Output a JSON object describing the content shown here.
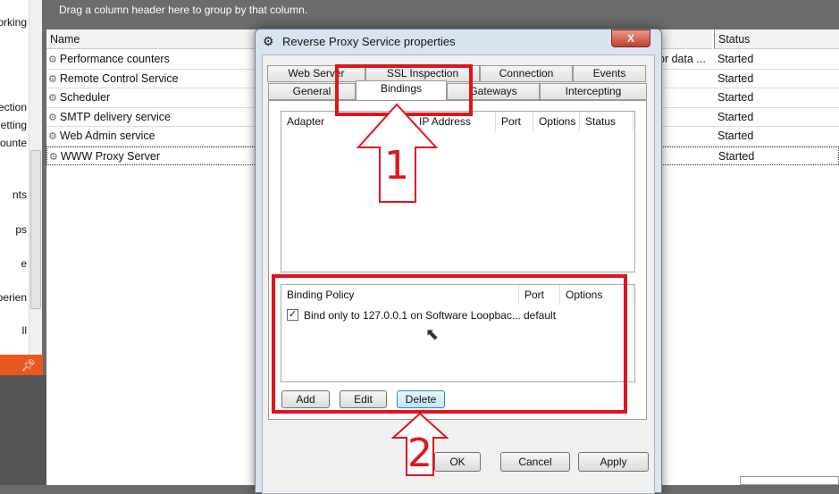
{
  "sidebar": {
    "items": [
      "orking",
      "ection",
      "etting",
      "ounte",
      "nts",
      "ps",
      "e",
      "perien",
      "ll"
    ]
  },
  "grid": {
    "group_hint": "Drag a column header here to group by that column.",
    "columns": [
      "Name",
      "Status"
    ],
    "rows": [
      {
        "name": "Performance counters",
        "desc": "or data ...",
        "status": "Started"
      },
      {
        "name": "Remote Control Service",
        "desc": "",
        "status": "Started"
      },
      {
        "name": "Scheduler",
        "desc": "",
        "status": "Started"
      },
      {
        "name": "SMTP delivery service",
        "desc": "",
        "status": "Started"
      },
      {
        "name": "Web Admin service",
        "desc": "",
        "status": "Started"
      },
      {
        "name": "WWW Proxy Server",
        "desc": "",
        "status": "Started"
      }
    ]
  },
  "dialog": {
    "title": "Reverse Proxy Service properties",
    "close": "X",
    "tabs_row1": [
      "Web Server",
      "SSL Inspection",
      "Connection",
      "Events"
    ],
    "tabs_row2": [
      "General",
      "Bindings",
      "Gateways",
      "Intercepting"
    ],
    "active_tab": "Bindings",
    "adapter_columns": [
      "Adapter",
      "IP Address",
      "Port",
      "Options",
      "Status"
    ],
    "policy_columns": [
      "Binding Policy",
      "Port",
      "Options"
    ],
    "policies": [
      {
        "checked": true,
        "policy": "Bind only to 127.0.0.1 on Software Loopbac...",
        "port": "default",
        "options": ""
      }
    ],
    "buttons": {
      "add": "Add",
      "edit": "Edit",
      "delete": "Delete",
      "ok": "OK",
      "cancel": "Cancel",
      "apply": "Apply"
    }
  },
  "annotations": {
    "step1": "1",
    "step2": "2",
    "color": "#e0141e"
  },
  "pin_icon": "pin-icon"
}
